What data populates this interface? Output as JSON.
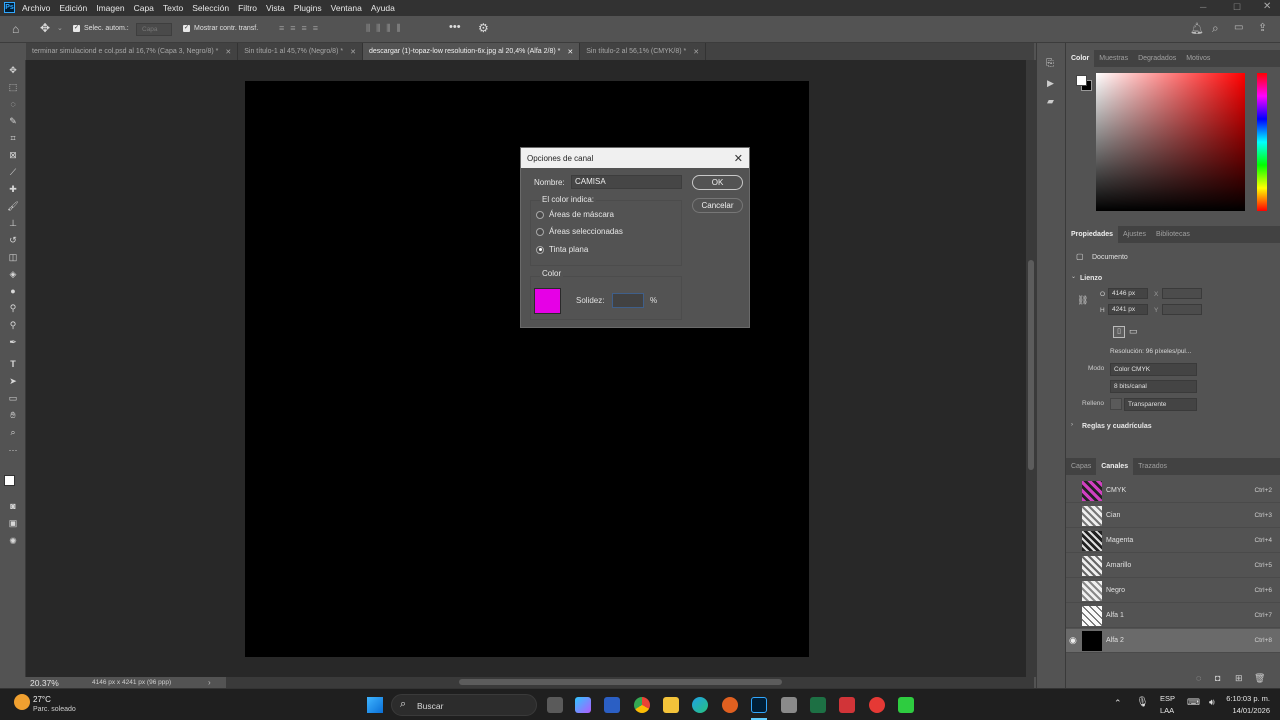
{
  "menubar": {
    "logo": "Ps",
    "items": [
      "Archivo",
      "Edición",
      "Imagen",
      "Capa",
      "Texto",
      "Selección",
      "Filtro",
      "Vista",
      "Plugins",
      "Ventana",
      "Ayuda"
    ]
  },
  "options": {
    "auto_select_label": "Selec. autom.:",
    "auto_select_value": "Capa",
    "show_transform_label": "Mostrar contr. transf."
  },
  "doc_tabs": [
    {
      "label": "terminar simulaciond e col.psd al 16,7% (Capa 3, Negro/8) *"
    },
    {
      "label": "Sin título-1 al 45,7% (Negro/8) *"
    },
    {
      "label": "descargar (1)-topaz-low resolution-6x.jpg al 20,4% (Alfa 2/8) *",
      "active": true
    },
    {
      "label": "Sin título-2 al 56,1% (CMYK/8) *"
    }
  ],
  "status": {
    "zoom": "20.37%",
    "size": "4146 px x 4241 px (96 ppp)"
  },
  "dialog": {
    "title": "Opciones de canal",
    "name_label": "Nombre:",
    "name_value": "CAMISA",
    "ok": "OK",
    "cancel": "Cancelar",
    "indicates_label": "El color indica:",
    "options": [
      "Áreas de máscara",
      "Áreas seleccionadas",
      "Tinta plana"
    ],
    "selected_option": "Tinta plana",
    "color_label": "Color",
    "color_swatch": "#e600e6",
    "solidity_label": "Solidez:",
    "solidity_value": "",
    "percent": "%"
  },
  "color_panel": {
    "tabs": [
      "Color",
      "Muestras",
      "Degradados",
      "Motivos"
    ]
  },
  "properties_panel": {
    "tabs": [
      "Propiedades",
      "Ajustes",
      "Bibliotecas"
    ],
    "doc_label": "Documento",
    "canvas_section": "Lienzo",
    "w_label": "O",
    "w_value": "4146 px",
    "h_label": "H",
    "h_value": "4241 px",
    "x_label": "X",
    "y_label": "Y",
    "resolution": "Resolución: 96 píxeles/pul...",
    "mode_label": "Modo",
    "mode_value": "Color CMYK",
    "bits_value": "8 bits/canal",
    "fill_label": "Relleno",
    "fill_value": "Transparente",
    "rulers_section": "Reglas y cuadrículas"
  },
  "channels_panel": {
    "tabs": [
      "Capas",
      "Canales",
      "Trazados"
    ],
    "channels": [
      {
        "name": "CMYK",
        "shortcut": "Ctrl+2"
      },
      {
        "name": "Cian",
        "shortcut": "Ctrl+3"
      },
      {
        "name": "Magenta",
        "shortcut": "Ctrl+4"
      },
      {
        "name": "Amarillo",
        "shortcut": "Ctrl+5"
      },
      {
        "name": "Negro",
        "shortcut": "Ctrl+6"
      },
      {
        "name": "Alfa 1",
        "shortcut": "Ctrl+7"
      },
      {
        "name": "Alfa 2",
        "shortcut": "Ctrl+8"
      }
    ]
  },
  "taskbar": {
    "weather_temp": "27°C",
    "weather_desc": "Parc. soleado",
    "search_label": "Buscar",
    "lang_top": "ESP",
    "lang_bottom": "LAA",
    "time": "6:10:03 p. m.",
    "date": "14/01/2026"
  }
}
